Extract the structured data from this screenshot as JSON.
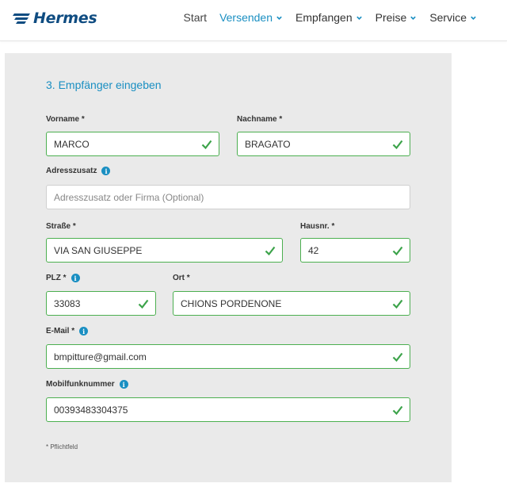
{
  "brand": {
    "name": "Hermes",
    "color": "#0f4c81"
  },
  "nav": {
    "items": [
      {
        "label": "Start",
        "dropdown": false,
        "active": false
      },
      {
        "label": "Versenden",
        "dropdown": true,
        "active": true
      },
      {
        "label": "Empfangen",
        "dropdown": true,
        "active": false
      },
      {
        "label": "Preise",
        "dropdown": true,
        "active": false
      },
      {
        "label": "Service",
        "dropdown": true,
        "active": false
      }
    ]
  },
  "form": {
    "title": "3. Empfänger eingeben",
    "fields": {
      "vorname": {
        "label": "Vorname *",
        "value": "MARCO",
        "valid": true
      },
      "nachname": {
        "label": "Nachname *",
        "value": "BRAGATO",
        "valid": true
      },
      "adresszusatz": {
        "label": "Adresszusatz",
        "value": "",
        "placeholder": "Adresszusatz oder Firma (Optional)",
        "info": true
      },
      "strasse": {
        "label": "Straße *",
        "value": "VIA SAN GIUSEPPE",
        "valid": true
      },
      "hausnr": {
        "label": "Hausnr. *",
        "value": "42",
        "valid": true
      },
      "plz": {
        "label": "PLZ *",
        "value": "33083",
        "valid": true,
        "info": true
      },
      "ort": {
        "label": "Ort *",
        "value": "CHIONS PORDENONE",
        "valid": true
      },
      "email": {
        "label": "E-Mail *",
        "value": "bmpitture@gmail.com",
        "valid": true,
        "info": true
      },
      "mobil": {
        "label": "Mobilfunknummer",
        "value": "00393483304375",
        "valid": true,
        "info": true
      }
    },
    "footnote": "* Pflichtfeld"
  },
  "colors": {
    "accent": "#1a8fc2",
    "valid": "#4caf50",
    "panel": "#eaeaea"
  },
  "icons": {
    "info": "info-icon",
    "check": "check-icon",
    "chevron": "chevron-down-icon"
  }
}
